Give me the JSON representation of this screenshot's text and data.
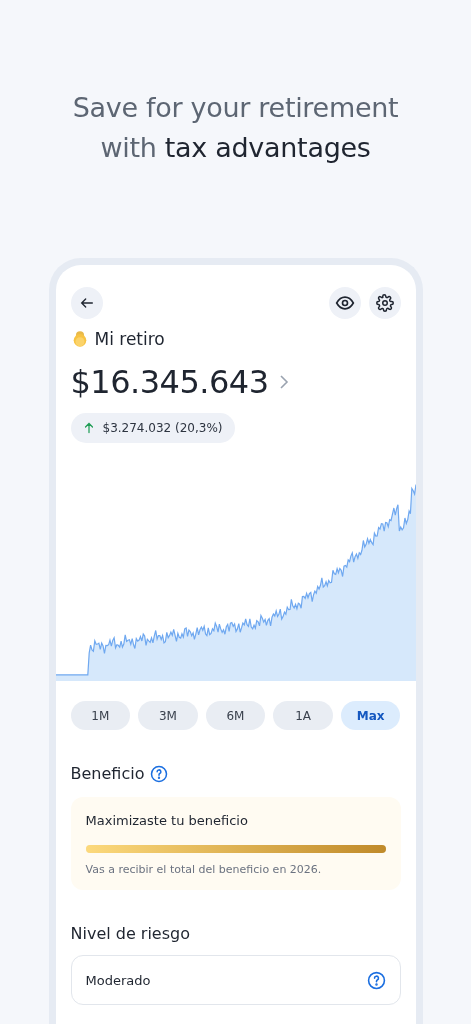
{
  "headline": "Save for your retirement\nwith **tax advantages**",
  "account": {
    "name": "Mi retiro",
    "balance": "$16.345.643",
    "gain": "$3.274.032 (20,3%)"
  },
  "ranges": [
    {
      "label": "1M",
      "selected": false
    },
    {
      "label": "3M",
      "selected": false
    },
    {
      "label": "6M",
      "selected": false
    },
    {
      "label": "1A",
      "selected": false
    },
    {
      "label": "Max",
      "selected": true
    }
  ],
  "benefit": {
    "title": "Beneficio",
    "card_title": "Maximizaste tu beneficio",
    "level": 1,
    "note": "Vas a recibir el total del beneficio en 2026."
  },
  "risk": {
    "title": "Nivel de riesgo",
    "value": "Moderado"
  }
}
